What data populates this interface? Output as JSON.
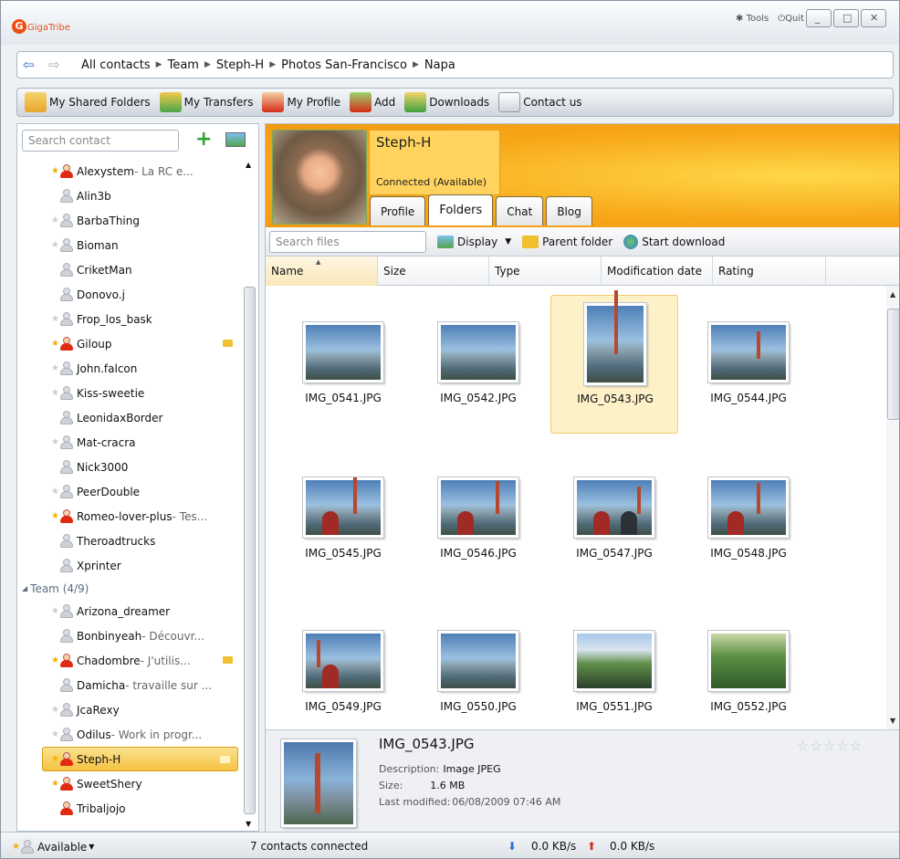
{
  "app": {
    "name": "GigaTribe"
  },
  "window": {
    "tools_label": "Tools",
    "quit_label": "Quit"
  },
  "breadcrumb": [
    "All contacts",
    "Team",
    "Steph-H",
    "Photos San-Francisco",
    "Napa"
  ],
  "toolbar": [
    "My Shared Folders",
    "My Transfers",
    "My Profile",
    "Add",
    "Downloads",
    "Contact us"
  ],
  "contacts_panel": {
    "search_placeholder": "Search contact",
    "contacts": [
      {
        "name": "Alexystem",
        "status": " - La RC e...",
        "star": "gold",
        "avatar": "red"
      },
      {
        "name": "Alin3b",
        "status": "",
        "star": "none",
        "avatar": "grey"
      },
      {
        "name": "BarbaThing",
        "status": "",
        "star": "grey",
        "avatar": "grey"
      },
      {
        "name": "Bioman",
        "status": "",
        "star": "grey",
        "avatar": "grey"
      },
      {
        "name": "CriketMan",
        "status": "",
        "star": "none",
        "avatar": "grey"
      },
      {
        "name": "Donovo.j",
        "status": "",
        "star": "none",
        "avatar": "grey"
      },
      {
        "name": "Frop_los_bask",
        "status": "",
        "star": "grey",
        "avatar": "grey"
      },
      {
        "name": "Giloup",
        "status": "",
        "star": "gold",
        "avatar": "red"
      },
      {
        "name": "John.falcon",
        "status": "",
        "star": "grey",
        "avatar": "grey"
      },
      {
        "name": "Kiss-sweetie",
        "status": "",
        "star": "grey",
        "avatar": "grey"
      },
      {
        "name": "LeonidaxBorder",
        "status": "",
        "star": "none",
        "avatar": "grey"
      },
      {
        "name": "Mat-cracra",
        "status": "",
        "star": "grey",
        "avatar": "grey"
      },
      {
        "name": "Nick3000",
        "status": "",
        "star": "none",
        "avatar": "grey"
      },
      {
        "name": "PeerDouble",
        "status": "",
        "star": "grey",
        "avatar": "grey"
      },
      {
        "name": "Romeo-lover-plus",
        "status": " - Tes...",
        "star": "gold",
        "avatar": "red"
      },
      {
        "name": "Theroadtrucks",
        "status": "",
        "star": "none",
        "avatar": "grey"
      },
      {
        "name": "Xprinter",
        "status": "",
        "star": "none",
        "avatar": "grey"
      }
    ],
    "group_label": "Team (4/9)",
    "team": [
      {
        "name": "Arizona_dreamer",
        "status": "",
        "star": "grey",
        "avatar": "grey"
      },
      {
        "name": "Bonbinyeah",
        "status": " - Découvr...",
        "star": "none",
        "avatar": "grey"
      },
      {
        "name": "Chadombre",
        "status": " - J'utilis...",
        "star": "gold",
        "avatar": "red"
      },
      {
        "name": "Damicha",
        "status": " - travaille sur ...",
        "star": "none",
        "avatar": "grey"
      },
      {
        "name": "JcaRexy",
        "status": "",
        "star": "grey",
        "avatar": "grey"
      },
      {
        "name": "Odilus",
        "status": " - Work in progr...",
        "star": "grey",
        "avatar": "grey"
      },
      {
        "name": "Steph-H",
        "status": "",
        "star": "gold",
        "avatar": "red"
      },
      {
        "name": "SweetShery",
        "status": "",
        "star": "gold",
        "avatar": "red"
      },
      {
        "name": "Tribaljojo",
        "status": "",
        "star": "none",
        "avatar": "red"
      }
    ]
  },
  "profile": {
    "name": "Steph-H",
    "status": "Connected (Available)",
    "tabs": [
      "Profile",
      "Folders",
      "Chat",
      "Blog"
    ],
    "active_tab": "Folders"
  },
  "files_toolbar": {
    "search_placeholder": "Search files",
    "display_label": "Display",
    "parent_label": "Parent folder",
    "download_label": "Start download"
  },
  "columns": [
    "Name",
    "Size",
    "Type",
    "Modification date",
    "Rating"
  ],
  "files": [
    "IMG_0541.JPG",
    "IMG_0542.JPG",
    "IMG_0543.JPG",
    "IMG_0544.JPG",
    "IMG_0545.JPG",
    "IMG_0546.JPG",
    "IMG_0547.JPG",
    "IMG_0548.JPG",
    "IMG_0549.JPG",
    "IMG_0550.JPG",
    "IMG_0551.JPG",
    "IMG_0552.JPG"
  ],
  "selected_file": "IMG_0543.JPG",
  "details": {
    "name": "IMG_0543.JPG",
    "description_label": "Description:",
    "description": "Image JPEG",
    "size_label": "Size:",
    "size": "1.6 MB",
    "modified_label": "Last modified:",
    "modified": "06/08/2009 07:46 AM"
  },
  "statusbar": {
    "availability": "Available",
    "connected": "7 contacts connected",
    "down_speed": "0.0 KB/s",
    "up_speed": "0.0 KB/s"
  },
  "colors": {
    "accent_orange": "#f7a718",
    "selection": "#f5c242",
    "link_blue": "#2a6bd2"
  }
}
